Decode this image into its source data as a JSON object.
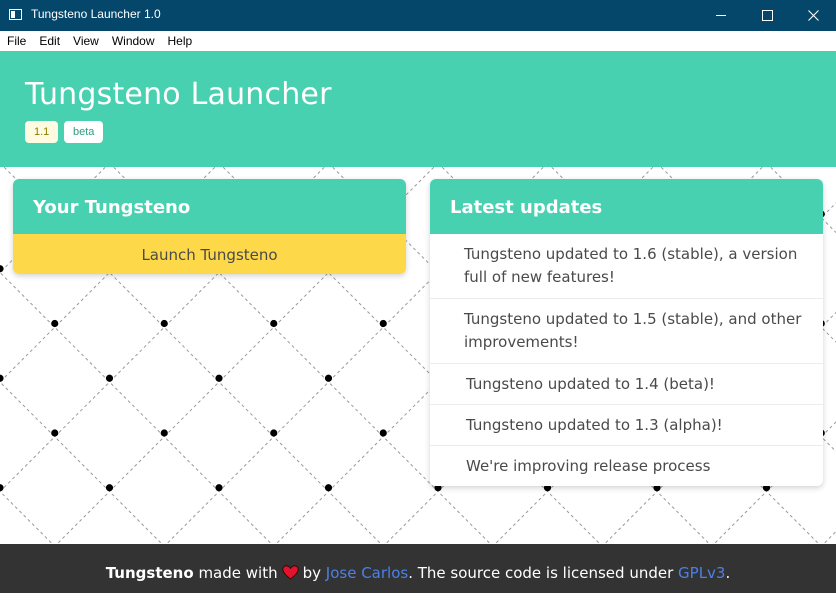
{
  "window": {
    "title": "Tungsteno Launcher 1.0"
  },
  "menu": [
    "File",
    "Edit",
    "View",
    "Window",
    "Help"
  ],
  "hero": {
    "title": "Tungsteno Launcher",
    "tags": [
      "1.1",
      "beta"
    ]
  },
  "your_card": {
    "title": "Your Tungsteno",
    "launch_label": "Launch Tungsteno"
  },
  "updates_card": {
    "title": "Latest updates",
    "items": [
      "Tungsteno updated to 1.6 (stable), a version full of new features!",
      "Tungsteno updated to 1.5 (stable), and other improvements!",
      "Tungsteno updated to 1.4 (beta)!",
      "Tungsteno updated to 1.3 (alpha)!",
      "We're improving release process"
    ]
  },
  "footer": {
    "brand": "Tungsteno",
    "made_with": "made with",
    "by": "by",
    "author": "Jose Carlos",
    "license_text": ". The source code is licensed under",
    "license": "GPLv3",
    "end": "."
  },
  "colors": {
    "titlebar": "#05466b",
    "accent": "#48d1b0",
    "launch": "#fdd94a",
    "footer": "#333333",
    "link": "#4b80e6",
    "heart": "#e0142d"
  },
  "icons": {
    "app": "window-icon",
    "minimize": "minimize-icon",
    "maximize": "maximize-icon",
    "close": "close-icon",
    "heart": "heart-icon"
  }
}
